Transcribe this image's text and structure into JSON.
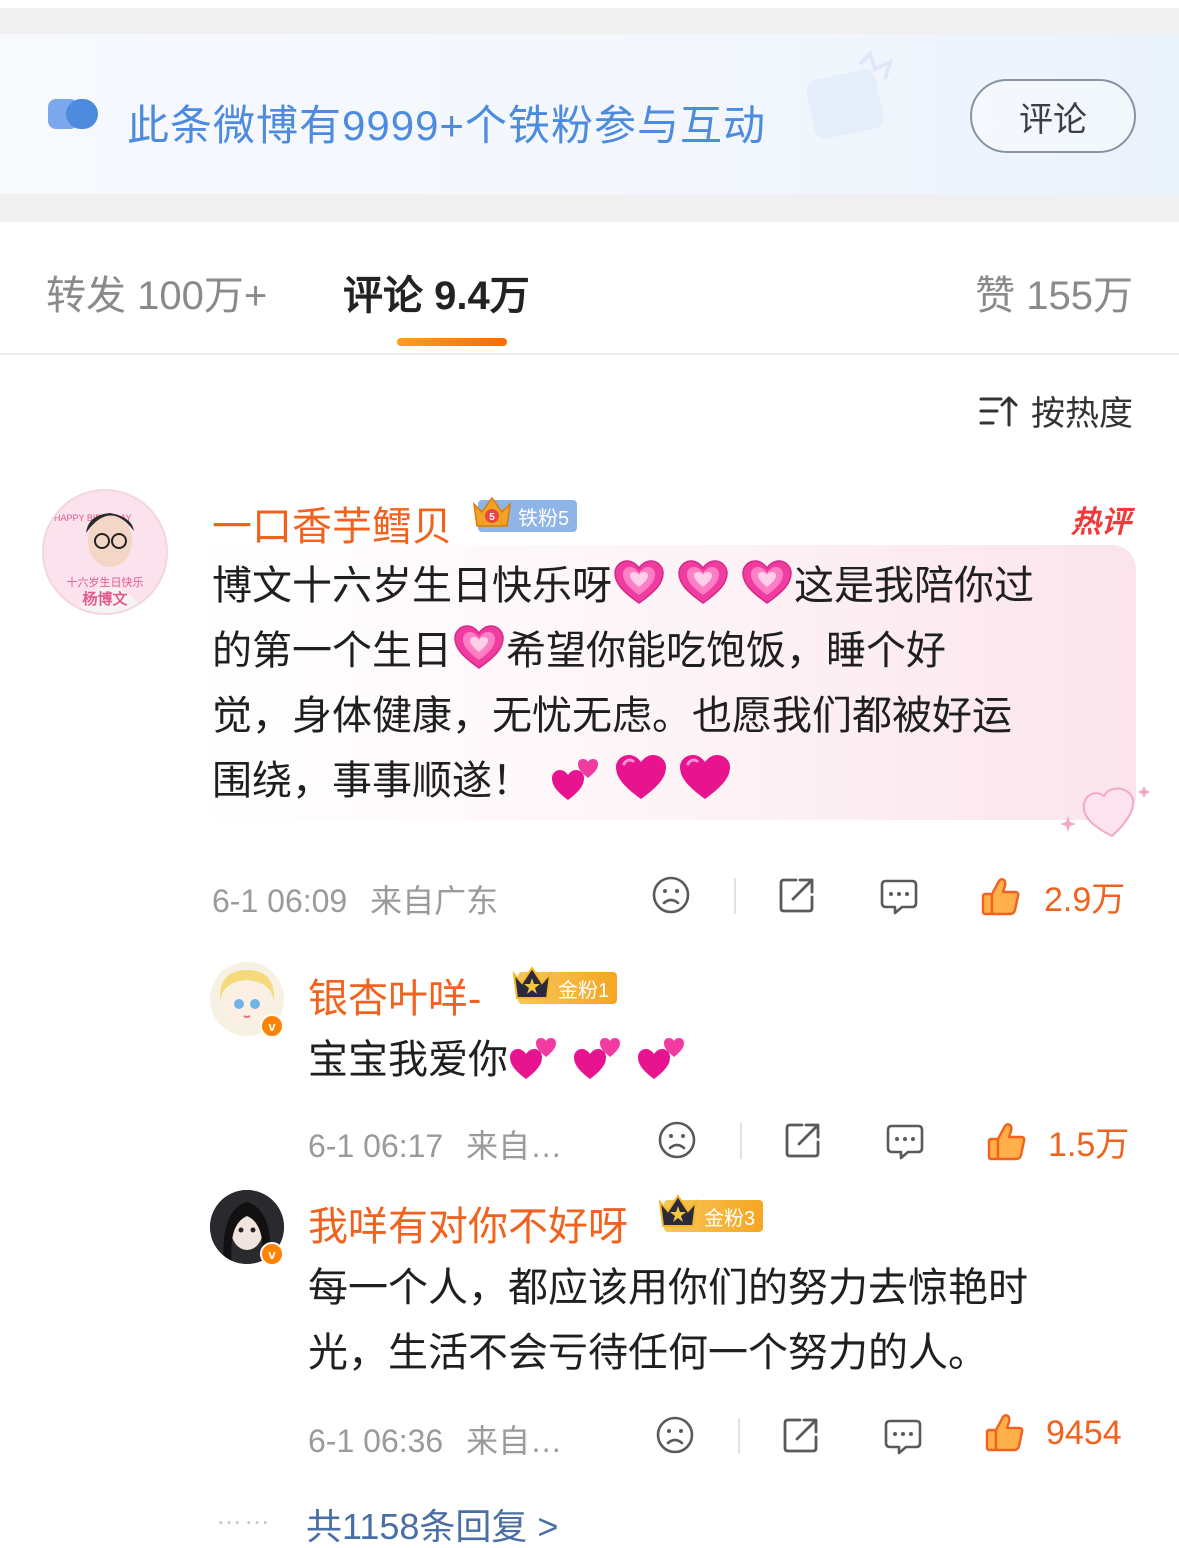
{
  "banner": {
    "text": "此条微博有9999+个铁粉参与互动",
    "button_label": "评论"
  },
  "tabs": {
    "repost": "转发 100万+",
    "comments": "评论 9.4万",
    "likes": "赞 155万"
  },
  "sort_label": "按热度",
  "hot_tag": "热评",
  "main_comment": {
    "username": "一口香芋鳕贝",
    "badge": "铁粉5",
    "avatar_text_1": "十六岁生日快乐",
    "avatar_text_2": "杨博文",
    "avatar_text_3": "HAPPY BIRTHDAY",
    "line1": "博文十六岁生日快乐呀",
    "line1b": "这是我陪你过",
    "line2a": "的第一个生日",
    "line2b": "希望你能吃饱饭，睡个好",
    "line3": "觉，身体健康，无忧无虑。也愿我们都被好运",
    "line4": "围绕，事事顺遂！",
    "time": "6-1 06:09",
    "location": "来自广东",
    "likes": "2.9万"
  },
  "replies": [
    {
      "username": "银杏叶咩-",
      "badge": "金粉1",
      "text": "宝宝我爱你",
      "time": "6-1 06:17",
      "location": "来自…",
      "likes": "1.5万"
    },
    {
      "username": "我咩有对你不好呀",
      "badge": "金粉3",
      "text_line1": "每一个人，都应该用你们的努力去惊艳时",
      "text_line2": "光，生活不会亏待任何一个努力的人。",
      "time": "6-1 06:36",
      "location": "来自…",
      "likes": "9454"
    }
  ],
  "more_replies": "共1158条回复 >",
  "more_dots": "……",
  "colors": {
    "accent_orange": "#f0621e",
    "link_blue": "#4d8bdf",
    "iron_badge": "#8fb4e6",
    "gold_badge": "#f5a623"
  },
  "icons": [
    "double-circle-icon",
    "sort-icon",
    "dislike-face-icon",
    "share-icon",
    "comment-icon",
    "thumbs-up-icon",
    "crown-icon",
    "heart-emoji-icon"
  ]
}
